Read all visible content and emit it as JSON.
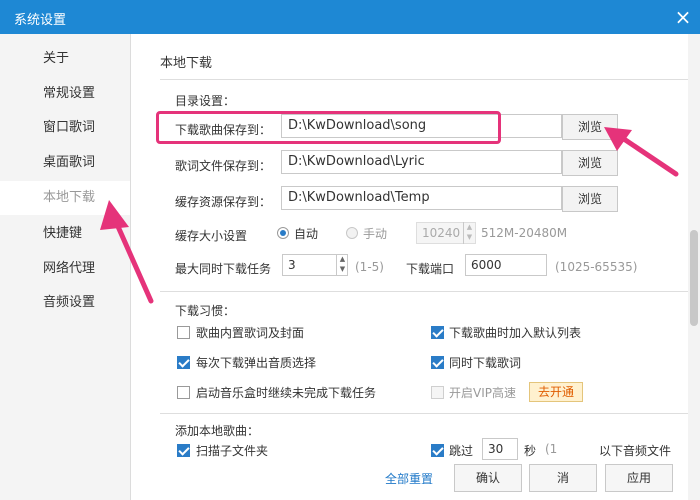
{
  "window": {
    "title": "系统设置",
    "close_icon": "close-icon"
  },
  "sidebar": {
    "items": [
      {
        "label": "关于"
      },
      {
        "label": "常规设置"
      },
      {
        "label": "窗口歌词"
      },
      {
        "label": "桌面歌词"
      },
      {
        "label": "本地下载",
        "active": true
      },
      {
        "label": "快捷键"
      },
      {
        "label": "网络代理"
      },
      {
        "label": "音频设置"
      }
    ]
  },
  "main": {
    "section_title": "本地下载",
    "directory": {
      "heading": "目录设置：",
      "rows": [
        {
          "label": "下载歌曲保存到：",
          "value": "D:\\KwDownload\\song",
          "button": "浏览"
        },
        {
          "label": "歌词文件保存到：",
          "value": "D:\\KwDownload\\Lyric",
          "button": "浏览"
        },
        {
          "label": "缓存资源保存到：",
          "value": "D:\\KwDownload\\Temp",
          "button": "浏览"
        }
      ]
    },
    "cache": {
      "label": "缓存大小设置",
      "auto": "自动",
      "manual": "手动",
      "value": "10240",
      "range": "512M-20480M"
    },
    "tasks": {
      "label": "最大同时下载任务",
      "value": "3",
      "range": "(1-5)",
      "port_label": "下载端口",
      "port_value": "6000",
      "port_range": "(1025-65535)"
    },
    "habits": {
      "heading": "下载习惯：",
      "options": [
        {
          "label": "歌曲内置歌词及封面",
          "checked": false
        },
        {
          "label": "下载歌曲时加入默认列表",
          "checked": true
        },
        {
          "label": "每次下载弹出音质选择",
          "checked": true
        },
        {
          "label": "同时下载歌词",
          "checked": true
        },
        {
          "label": "启动音乐盒时继续未完成下载任务",
          "checked": false
        },
        {
          "label": "开启VIP高速",
          "checked": false
        }
      ],
      "vip_badge": "去开通"
    },
    "local_songs": {
      "heading": "添加本地歌曲：",
      "scan_label": "扫描子文件夹",
      "skip_label": "跳过",
      "skip_value": "30",
      "skip_unit": "秒",
      "skip_suffix_partial": "(1",
      "skip_suffix": "以下音频文件"
    }
  },
  "footer": {
    "reset_link": "全部重置",
    "confirm": "确认",
    "cancel_partial": "消",
    "apply": "应用"
  },
  "colors": {
    "title_blue": "#1e88d4",
    "annotation_pink": "#e5337a",
    "checkbox_blue": "#2a7cc7",
    "link_blue": "#1f78c8"
  }
}
